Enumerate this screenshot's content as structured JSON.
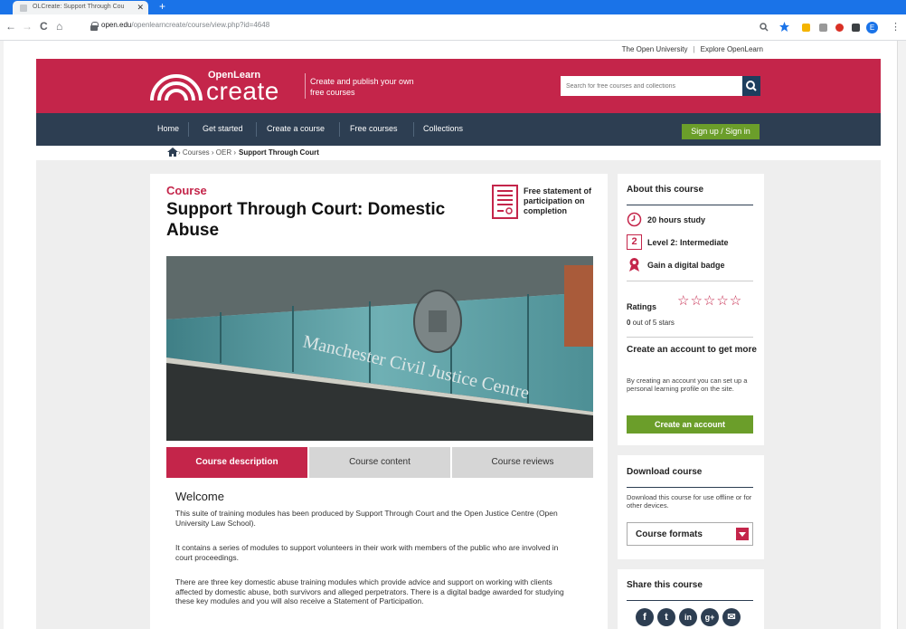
{
  "browser": {
    "tab_title": "OLCreate: Support Through Cou",
    "tab_close": "✕",
    "new_tab": "+",
    "url_host": "open.edu",
    "url_path": "/openlearncreate/course/view.php?id=4648",
    "nav_back": "←",
    "nav_forward": "→",
    "nav_reload": "C",
    "nav_home": "⌂",
    "menu": "⋮",
    "profile_initial": "E"
  },
  "top_links": {
    "open_university": "The Open University",
    "separator": "|",
    "explore": "Explore OpenLearn"
  },
  "header": {
    "logo_small": "OpenLearn",
    "logo_main": "create",
    "tagline": "Create and publish your own free courses",
    "search_placeholder": "Search for free courses and collections"
  },
  "nav": {
    "items": [
      "Home",
      "Get started",
      "Create a course",
      "Free courses",
      "Collections"
    ],
    "signup": "Sign up / Sign in"
  },
  "breadcrumb": {
    "path": "› Courses › OER ›",
    "current": "Support Through Court"
  },
  "course": {
    "kicker": "Course",
    "title": "Support Through Court: Domestic Abuse",
    "certificate": "Free statement of participation on completion",
    "image_sign_text": "Manchester Civil Justice Centre"
  },
  "tabs": {
    "description": "Course description",
    "content": "Course content",
    "reviews": "Course reviews"
  },
  "description": {
    "heading": "Welcome",
    "paragraphs": [
      "This suite of training modules has been produced by Support Through Court and the Open Justice Centre (Open University Law School).",
      "It contains a series of modules to support volunteers in their work with members of the public who are involved in court proceedings.",
      "There are three key domestic abuse training modules which provide advice and support on working with clients affected by domestic abuse, both survivors and alleged perpetrators. There is a digital badge awarded for studying these key modules and you will also receive a Statement of Participation."
    ]
  },
  "about": {
    "heading": "About this course",
    "hours": "20 hours study",
    "level_number": "2",
    "level": "Level 2: Intermediate",
    "badge": "Gain a digital badge",
    "ratings_label": "Ratings",
    "stars_glyphs": "☆☆☆☆☆",
    "rating_value": "0",
    "rating_suffix": " out of 5 stars",
    "account_heading": "Create an account to get more",
    "account_text": "By creating an account you can set up a personal learning profile on the site.",
    "account_button": "Create an account"
  },
  "download": {
    "heading": "Download course",
    "text": "Download this course for use offline or for other devices.",
    "formats": "Course formats"
  },
  "share": {
    "heading": "Share this course",
    "icons": [
      "f",
      "t",
      "in",
      "g+",
      "✉"
    ]
  },
  "colors": {
    "brand_red": "#c4254a",
    "navy": "#2d3e52",
    "green": "#6b9e2a",
    "chrome_blue": "#1a73e8"
  }
}
